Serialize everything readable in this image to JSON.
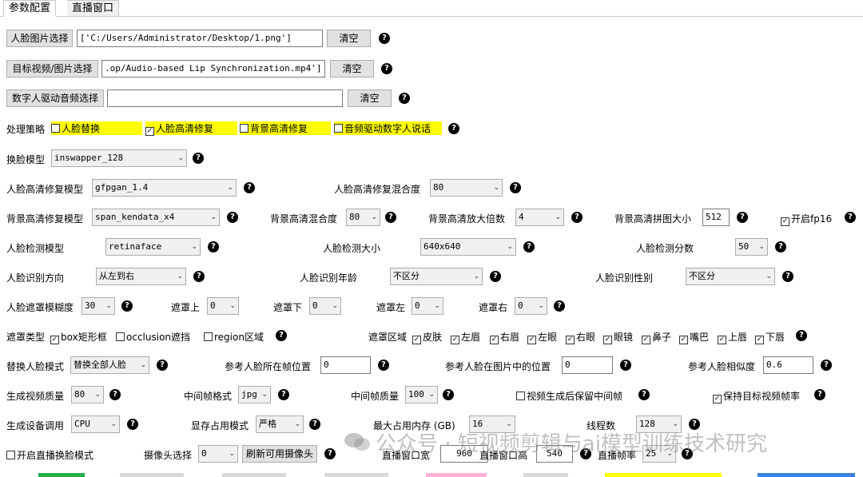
{
  "tabs": [
    "参数配置",
    "直播窗口"
  ],
  "face_image": {
    "button": "人脸图片选择",
    "value": "['C:/Users/Administrator/Desktop/1.png']",
    "clear": "清空"
  },
  "target_video": {
    "button": "目标视频/图片选择",
    "value": ".op/Audio-based Lip Synchronization.mp4']",
    "clear": "清空"
  },
  "audio": {
    "button": "数字人驱动音频选择",
    "value": "",
    "clear": "清空"
  },
  "strategy": {
    "label": "处理策略",
    "options": [
      {
        "label": "人脸替换",
        "checked": false
      },
      {
        "label": "人脸高清修复",
        "checked": true
      },
      {
        "label": "背景高清修复",
        "checked": false
      },
      {
        "label": "音频驱动数字人说话",
        "checked": false
      }
    ]
  },
  "swap_model": {
    "label": "换脸模型",
    "value": "inswapper_128"
  },
  "face_enhance_model": {
    "label": "人脸高清修复模型",
    "value": "gfpgan_1.4"
  },
  "face_enhance_blend": {
    "label": "人脸高清修复混合度",
    "value": "80"
  },
  "bg_enhance_model": {
    "label": "背景高清修复模型",
    "value": "span_kendata_x4"
  },
  "bg_blend": {
    "label": "背景高清混合度",
    "value": "80"
  },
  "bg_scale": {
    "label": "背景高清放大倍数",
    "value": "4"
  },
  "bg_tile": {
    "label": "背景高清拼图大小",
    "value": "512"
  },
  "fp16": {
    "label": "开启fp16",
    "checked": true
  },
  "detect_model": {
    "label": "人脸检测模型",
    "value": "retinaface"
  },
  "detect_size": {
    "label": "人脸检测大小",
    "value": "640x640"
  },
  "detect_score": {
    "label": "人脸检测分数",
    "value": "50"
  },
  "recog_dir": {
    "label": "人脸识别方向",
    "value": "从左到右"
  },
  "recog_age": {
    "label": "人脸识别年龄",
    "value": "不区分"
  },
  "recog_gender": {
    "label": "人脸识别性别",
    "value": "不区分"
  },
  "mask_blur": {
    "label": "人脸遮罩模糊度",
    "value": "30"
  },
  "mask_top": {
    "label": "遮罩上",
    "value": "0"
  },
  "mask_bottom": {
    "label": "遮罩下",
    "value": "0"
  },
  "mask_left": {
    "label": "遮罩左",
    "value": "0"
  },
  "mask_right": {
    "label": "遮罩右",
    "value": "0"
  },
  "mask_type": {
    "label": "遮罩类型",
    "options": [
      {
        "label": "box矩形框",
        "checked": true
      },
      {
        "label": "occlusion遮挡",
        "checked": false
      },
      {
        "label": "region区域",
        "checked": false
      }
    ]
  },
  "mask_region": {
    "label": "遮罩区域",
    "options": [
      {
        "label": "皮肤",
        "checked": true
      },
      {
        "label": "左眉",
        "checked": true
      },
      {
        "label": "右眉",
        "checked": true
      },
      {
        "label": "左眼",
        "checked": true
      },
      {
        "label": "右眼",
        "checked": true
      },
      {
        "label": "眼镜",
        "checked": true
      },
      {
        "label": "鼻子",
        "checked": true
      },
      {
        "label": "嘴巴",
        "checked": true
      },
      {
        "label": "上唇",
        "checked": true
      },
      {
        "label": "下唇",
        "checked": true
      }
    ]
  },
  "replace_mode": {
    "label": "替换人脸模式",
    "value": "替换全部人脸"
  },
  "ref_frame": {
    "label": "参考人脸所在帧位置",
    "value": "0"
  },
  "ref_pos": {
    "label": "参考人脸在图片中的位置",
    "value": "0"
  },
  "ref_sim": {
    "label": "参考人脸相似度",
    "value": "0.6"
  },
  "video_quality": {
    "label": "生成视频质量",
    "value": "80"
  },
  "frame_format": {
    "label": "中间帧格式",
    "value": "jpg"
  },
  "frame_quality": {
    "label": "中间帧质量",
    "value": "100"
  },
  "keep_frames": {
    "label": "视频生成后保留中间帧",
    "checked": false
  },
  "keep_fps": {
    "label": "保持目标视频帧率",
    "checked": true
  },
  "device": {
    "label": "生成设备调用",
    "value": "CPU"
  },
  "vram_mode": {
    "label": "显存占用模式",
    "value": "严格"
  },
  "max_mem": {
    "label": "最大占用内存 (GB)",
    "value": "16"
  },
  "threads": {
    "label": "线程数",
    "value": "128"
  },
  "live_mode": {
    "label": "开启直播换脸模式",
    "checked": false
  },
  "camera": {
    "label": "摄像头选择",
    "value": "0",
    "refresh": "刷新可用摄像头"
  },
  "live_w": {
    "label": "直播窗口宽",
    "value": "960"
  },
  "live_h": {
    "label": "直播窗口高",
    "value": "540"
  },
  "live_fps": {
    "label": "直播帧率",
    "value": "25"
  },
  "watermark": "公众号 · 短视频剪辑与ai模型训练技术研究",
  "help_glyph": "?",
  "check_glyph": "✓",
  "arrow_glyph": "⌄"
}
